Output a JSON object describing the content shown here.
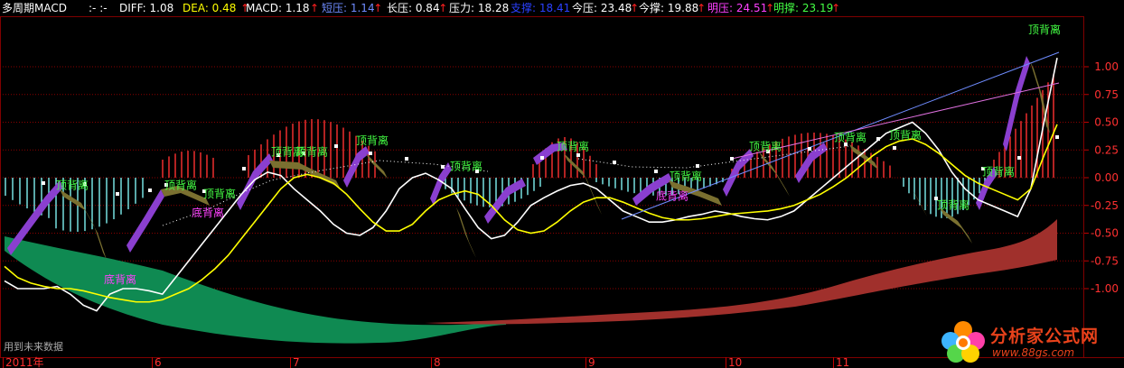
{
  "header": {
    "title": "多周期MACD",
    "sep": ":- :-",
    "items": [
      {
        "label": "DIFF: 1.08",
        "color": "#ffffff",
        "arrow": false
      },
      {
        "label": "DEA: 0.48",
        "color": "#ffff00",
        "arrow": true
      },
      {
        "label": "MACD: 1.18",
        "color": "#ffffff",
        "arrow": true
      },
      {
        "label": "短压: 1.14",
        "color": "#6f8cff",
        "arrow": true
      },
      {
        "label": "长压: 0.84",
        "color": "#ffffff",
        "arrow": true
      },
      {
        "label": "压力: 18.28",
        "color": "#ffffff",
        "arrow": false
      },
      {
        "label": "支撑: 18.41",
        "color": "#2a40ff",
        "arrow": false
      },
      {
        "label": "今压: 23.48",
        "color": "#ffffff",
        "arrow": true
      },
      {
        "label": "今撑: 19.88",
        "color": "#ffffff",
        "arrow": true
      },
      {
        "label": "明压: 24.51",
        "color": "#ff40ff",
        "arrow": true
      },
      {
        "label": "明撑: 23.19",
        "color": "#44ff44",
        "arrow": true
      }
    ]
  },
  "footer": {
    "note": "用到未来数据"
  },
  "logo": {
    "name": "分析家公式网",
    "url": "www.88gs.com"
  },
  "chart_data": {
    "type": "line",
    "ylim": [
      -1.25,
      1.25
    ],
    "y_ticks": [
      "1.00",
      "0.75",
      "0.50",
      "0.25",
      "0.00",
      "-0.25",
      "-0.50",
      "-0.75",
      "-1.00"
    ],
    "x_labels": [
      "2011年",
      "6",
      "7",
      "8",
      "9",
      "10",
      "11"
    ],
    "series": [
      {
        "name": "DIFF",
        "color": "#ffffff",
        "x": [
          0,
          1,
          2,
          3,
          4,
          5,
          6,
          7,
          8,
          9,
          10,
          11,
          12,
          13,
          14,
          15,
          16,
          17,
          18,
          19,
          20,
          21,
          22,
          23,
          24,
          25,
          26,
          27,
          28,
          29,
          30,
          31,
          32,
          33,
          34,
          35,
          36,
          37,
          38,
          39,
          40,
          41,
          42,
          43,
          44,
          45,
          46,
          47,
          48,
          49,
          50,
          51,
          52,
          53,
          54,
          55,
          56,
          57,
          58,
          59,
          60,
          61,
          62,
          63,
          64,
          65,
          66,
          67,
          68,
          69,
          70,
          71,
          72,
          73,
          74,
          75,
          76,
          77,
          78,
          79,
          80
        ],
        "values": [
          -0.93,
          -1.0,
          -1.0,
          -1.0,
          -0.98,
          -1.05,
          -1.15,
          -1.2,
          -1.05,
          -1.0,
          -1.0,
          -1.02,
          -1.05,
          -0.9,
          -0.75,
          -0.6,
          -0.45,
          -0.3,
          -0.15,
          -0.02,
          0.05,
          0.02,
          -0.1,
          -0.2,
          -0.3,
          -0.42,
          -0.5,
          -0.52,
          -0.45,
          -0.3,
          -0.1,
          0.0,
          0.04,
          -0.02,
          -0.1,
          -0.28,
          -0.45,
          -0.55,
          -0.52,
          -0.4,
          -0.25,
          -0.18,
          -0.12,
          -0.07,
          -0.05,
          -0.1,
          -0.2,
          -0.3,
          -0.35,
          -0.4,
          -0.4,
          -0.38,
          -0.35,
          -0.33,
          -0.3,
          -0.32,
          -0.35,
          -0.37,
          -0.38,
          -0.35,
          -0.3,
          -0.2,
          -0.1,
          0.0,
          0.1,
          0.2,
          0.3,
          0.4,
          0.45,
          0.5,
          0.4,
          0.25,
          0.05,
          -0.1,
          -0.2,
          -0.25,
          -0.3,
          -0.35,
          -0.1,
          0.5,
          1.08
        ]
      },
      {
        "name": "DEA",
        "color": "#ffff00",
        "values": [
          -0.8,
          -0.9,
          -0.95,
          -0.98,
          -1.0,
          -1.0,
          -1.02,
          -1.05,
          -1.08,
          -1.1,
          -1.12,
          -1.12,
          -1.1,
          -1.05,
          -1.0,
          -0.92,
          -0.82,
          -0.7,
          -0.55,
          -0.4,
          -0.25,
          -0.1,
          0.0,
          0.03,
          0.0,
          -0.05,
          -0.15,
          -0.28,
          -0.4,
          -0.48,
          -0.48,
          -0.42,
          -0.3,
          -0.2,
          -0.15,
          -0.12,
          -0.15,
          -0.25,
          -0.38,
          -0.47,
          -0.5,
          -0.48,
          -0.4,
          -0.3,
          -0.22,
          -0.18,
          -0.18,
          -0.22,
          -0.27,
          -0.32,
          -0.36,
          -0.38,
          -0.38,
          -0.37,
          -0.35,
          -0.33,
          -0.32,
          -0.31,
          -0.3,
          -0.28,
          -0.25,
          -0.2,
          -0.15,
          -0.08,
          0.0,
          0.1,
          0.2,
          0.28,
          0.33,
          0.35,
          0.3,
          0.22,
          0.12,
          0.02,
          -0.05,
          -0.1,
          -0.15,
          -0.2,
          -0.1,
          0.2,
          0.48
        ]
      },
      {
        "name": "MACD",
        "color": "#ff3030",
        "values": [
          0,
          0,
          0,
          0,
          0,
          0,
          0,
          0,
          0,
          0,
          0,
          0,
          0,
          0,
          0,
          0,
          0,
          0,
          0,
          0,
          0,
          0,
          0,
          0,
          0,
          0,
          0,
          0,
          0,
          0,
          0,
          0,
          0,
          0,
          0,
          0,
          0,
          0,
          0,
          0,
          0,
          0,
          0,
          0,
          0,
          0,
          0,
          0,
          0,
          0,
          0,
          0,
          0,
          0,
          0,
          0,
          0,
          0,
          0,
          0,
          0,
          0,
          0,
          0,
          0,
          0,
          0,
          0,
          0,
          0,
          0,
          0,
          0,
          0,
          0,
          0,
          0,
          0,
          0,
          0,
          1.18
        ]
      }
    ],
    "annotations": [
      {
        "text": "顶背离",
        "color": "#44ff44",
        "x": 80,
        "y": -0.1
      },
      {
        "text": "顶背离",
        "color": "#44ff44",
        "x": 200,
        "y": -0.1
      },
      {
        "text": "顶背离",
        "color": "#44ff44",
        "x": 243,
        "y": -0.18
      },
      {
        "text": "底背离",
        "color": "#ff40ff",
        "x": 230,
        "y": -0.35
      },
      {
        "text": "顶背离",
        "color": "#44ff44",
        "x": 318,
        "y": 0.2
      },
      {
        "text": "顶背离",
        "color": "#44ff44",
        "x": 345,
        "y": 0.2
      },
      {
        "text": "顶背离",
        "color": "#44ff44",
        "x": 412,
        "y": 0.3
      },
      {
        "text": "顶背离",
        "color": "#44ff44",
        "x": 516,
        "y": 0.07
      },
      {
        "text": "顶背离",
        "color": "#44ff44",
        "x": 634,
        "y": 0.25
      },
      {
        "text": "顶背离",
        "color": "#44ff44",
        "x": 759,
        "y": -0.02
      },
      {
        "text": "底背离",
        "color": "#ff40ff",
        "x": 744,
        "y": -0.2
      },
      {
        "text": "顶背离",
        "color": "#44ff44",
        "x": 847,
        "y": 0.25
      },
      {
        "text": "顶背离",
        "color": "#44ff44",
        "x": 941,
        "y": 0.33
      },
      {
        "text": "顶背离",
        "color": "#44ff44",
        "x": 1002,
        "y": 0.35
      },
      {
        "text": "顶背离",
        "color": "#44ff44",
        "x": 1055,
        "y": -0.28
      },
      {
        "text": "顶背离",
        "color": "#44ff44",
        "x": 1105,
        "y": 0.02
      },
      {
        "text": "顶背离",
        "color": "#44ff44",
        "x": 1156,
        "y": 1.3
      },
      {
        "text": "底背离",
        "color": "#ff40ff",
        "x": 133,
        "y": -0.95
      }
    ]
  }
}
